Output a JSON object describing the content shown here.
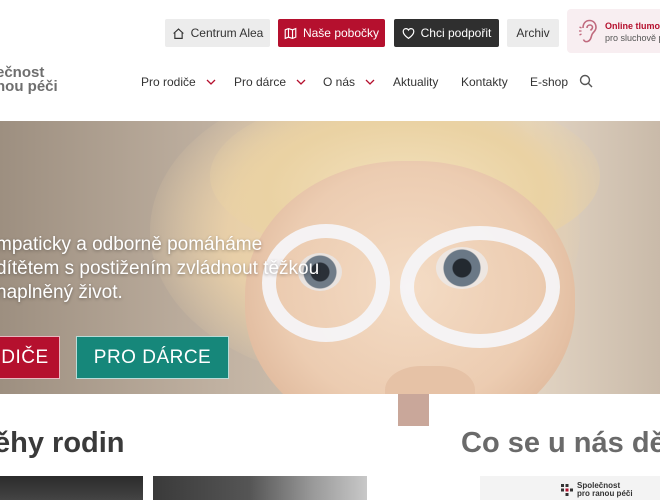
{
  "topbar": {
    "alea_label": "Centrum Alea",
    "pobocky_label": "Naše pobočky",
    "podporit_label": "Chci podpořit",
    "archiv_label": "Archiv",
    "tlumocnik_title": "Online tlumočer",
    "tlumocnik_sub": "pro sluchově po"
  },
  "logo": {
    "line1": "ečnost",
    "line2": "nou péči"
  },
  "nav": {
    "items": [
      {
        "label": "Pro rodiče",
        "has_dropdown": true
      },
      {
        "label": "Pro dárce",
        "has_dropdown": true
      },
      {
        "label": "O nás",
        "has_dropdown": true
      },
      {
        "label": "Aktuality",
        "has_dropdown": false
      },
      {
        "label": "Kontakty",
        "has_dropdown": false
      },
      {
        "label": "E-shop",
        "has_dropdown": false
      }
    ],
    "search_icon": "search-icon"
  },
  "hero": {
    "line1": "mpaticky a odborně pomáháme",
    "line2": "dítětem s postižením zvládnout těžkou",
    "line3": "naplněný život.",
    "cta_rodice": "DIČE",
    "cta_darce": "PRO DÁRCE"
  },
  "sections": {
    "pribehy_title": "ěhy rodin",
    "deje_title": "Co se u nás děj",
    "mini_logo_line1": "Společnost",
    "mini_logo_line2": "pro ranou péči"
  },
  "colors": {
    "brand_red": "#b5102e",
    "brand_teal": "#16877a",
    "dark_button": "#2f2f2f",
    "light_button": "#ececec"
  }
}
